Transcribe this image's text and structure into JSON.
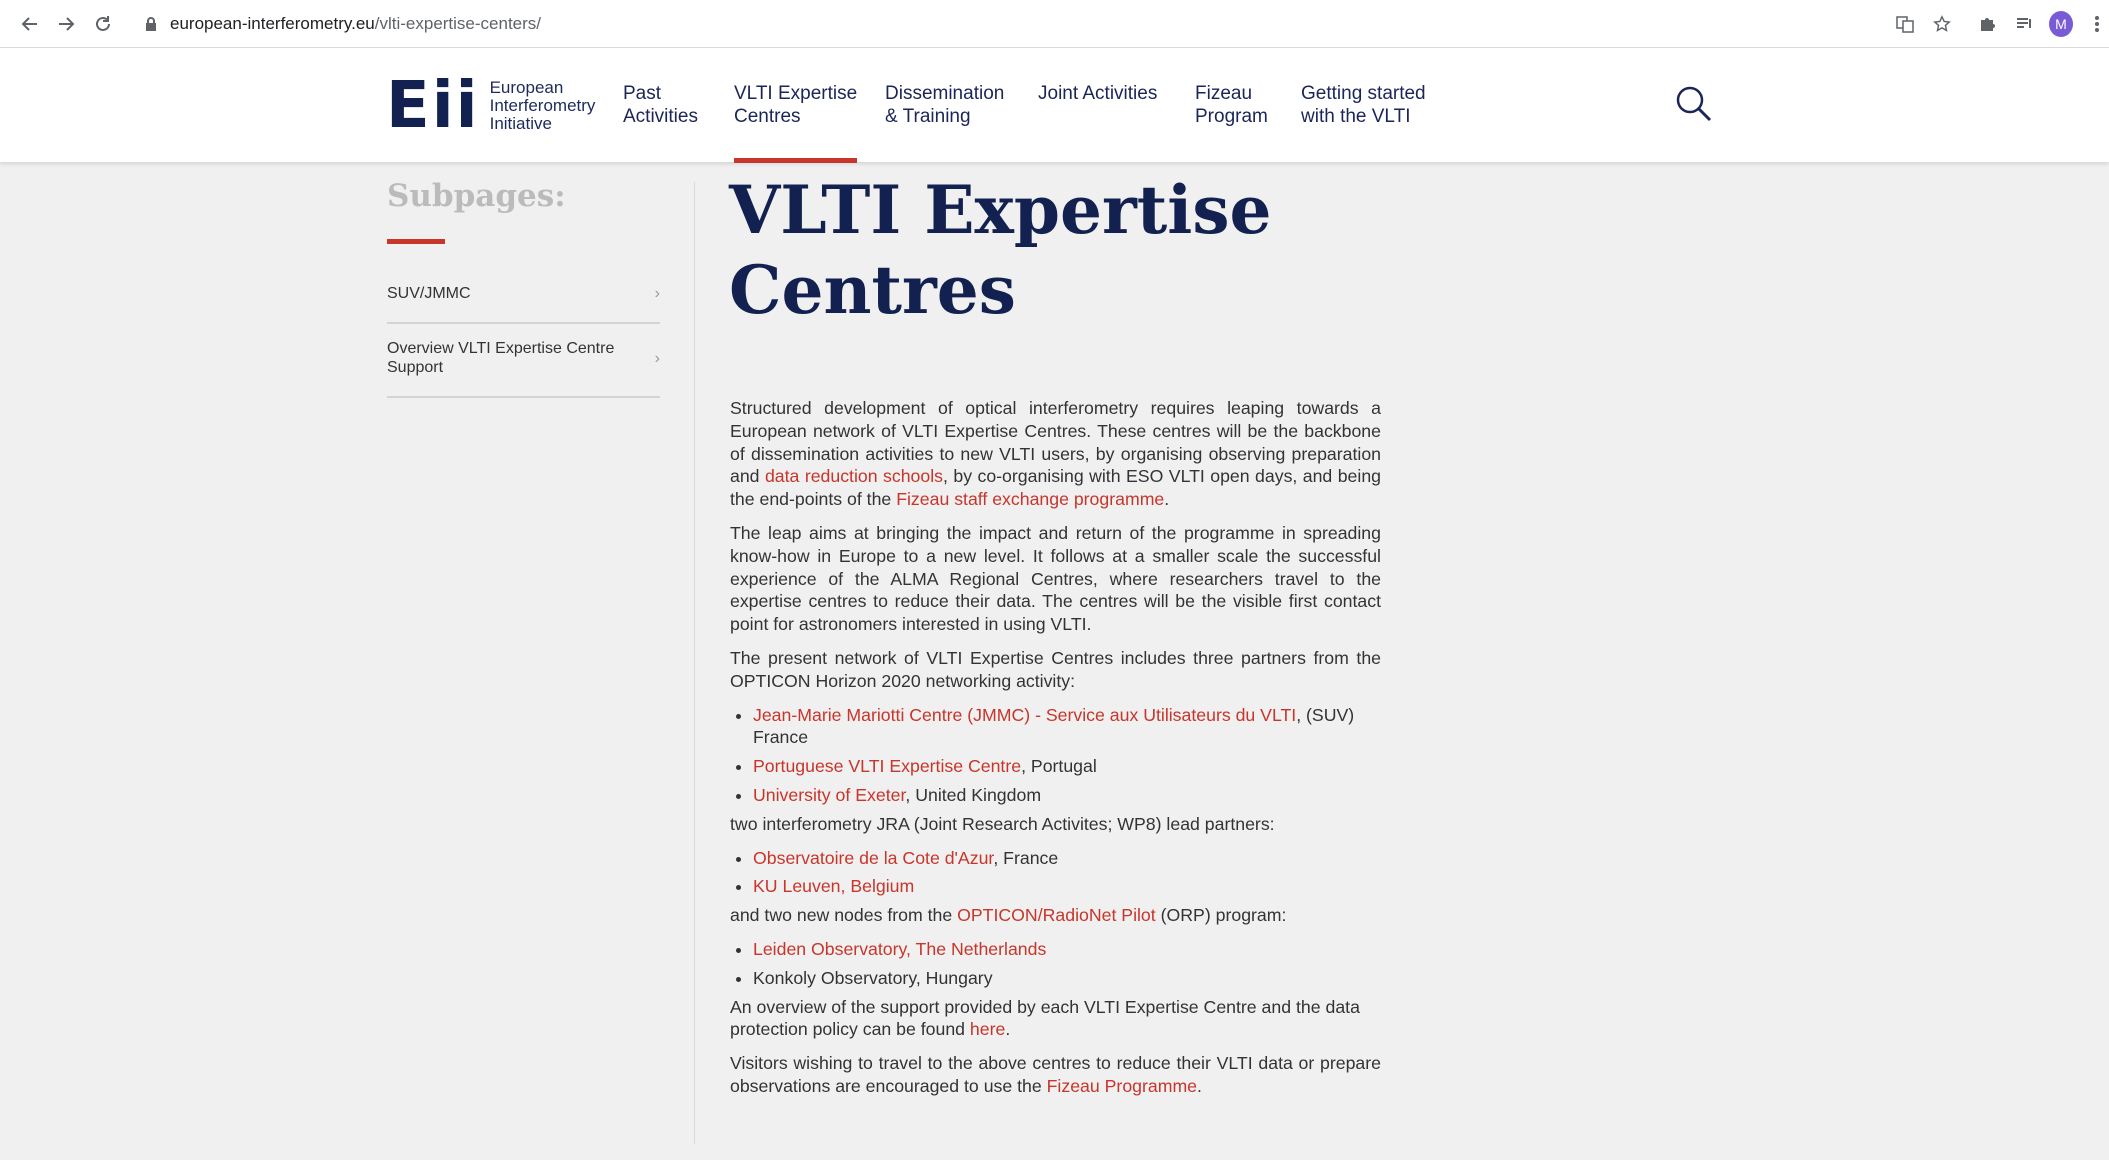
{
  "browser": {
    "url_domain": "european-interferometry.eu",
    "url_path": "/vlti-expertise-centers/",
    "avatar_letter": "M"
  },
  "header": {
    "logo_mark": "Eii",
    "logo_lines": [
      "European",
      "Interferometry",
      "Initiative"
    ],
    "menu": [
      {
        "label_1": "Past",
        "label_2": "Activities"
      },
      {
        "label_1": "VLTI Expertise",
        "label_2": "Centres"
      },
      {
        "label_1": "Dissemination",
        "label_2": "& Training"
      },
      {
        "label_1": "Joint Activities",
        "label_2": ""
      },
      {
        "label_1": "Fizeau",
        "label_2": "Program"
      },
      {
        "label_1": "Getting started",
        "label_2": "with the VLTI"
      }
    ],
    "accent_color": "#c8352a",
    "brand_color": "#12214f"
  },
  "sidebar": {
    "title": "Subpages:",
    "items": [
      {
        "label": "SUV/JMMC"
      },
      {
        "label_1": "Overview VLTI Expertise Centre",
        "label_2": "Support"
      }
    ]
  },
  "main": {
    "title_1": "VLTI Expertise",
    "title_2": "Centres",
    "p1": {
      "t1": "Structured development of optical interferometry requires leaping towards a European network of VLTI Expertise Centres. These centres will be the backbone of dissemination activities to new VLTI users, by organising observing preparation and ",
      "link1": "data reduction schools",
      "t2": ", by co-organising with ESO VLTI open days, and being the end-points of the ",
      "link2": "Fizeau staff exchange programme",
      "t3": "."
    },
    "p2": "The leap aims at bringing the impact and return of the programme in spreading know-how in Europe to a new level. It follows at a smaller scale the successful experience of the ALMA Regional Centres, where researchers travel to the expertise centres to reduce their data. The centres will be the visible first contact point for astronomers interested in using VLTI.",
    "p3": "The present network of VLTI Expertise Centres includes three partners from the OPTICON Horizon 2020 networking activity:",
    "partners": [
      {
        "link": "Jean-Marie Mariotti Centre (JMMC) - Service aux Utilisateurs du VLTI",
        "rest": ", (SUV) France"
      },
      {
        "link": "Portuguese VLTI Expertise Centre",
        "rest": ", Portugal"
      },
      {
        "link": "University of Exeter",
        "rest": ", United Kingdom"
      }
    ],
    "p4": "two interferometry JRA (Joint Research Activites; WP8) lead partners:",
    "jra": [
      {
        "link": "Observatoire de la Cote d'Azur",
        "rest": ", France"
      },
      {
        "link": "KU Leuven, Belgium",
        "rest": ""
      }
    ],
    "p5": {
      "t1": "and two new nodes from the ",
      "link": "OPTICON/RadioNet Pilot",
      "t2": " (ORP) program:"
    },
    "nodes": [
      {
        "link": "Leiden Observatory, The Netherlands",
        "rest": ""
      },
      {
        "link": "",
        "rest": "Konkoly Observatory, Hungary"
      }
    ],
    "p6": {
      "t1": "An overview of the support provided by each VLTI Expertise Centre and the data protection policy can be found ",
      "link": "here",
      "t2": "."
    },
    "p7": {
      "t1": "Visitors wishing to travel to the above centres to reduce their VLTI data or prepare observations are encouraged to use the ",
      "link": "Fizeau Programme",
      "t2": "."
    }
  }
}
